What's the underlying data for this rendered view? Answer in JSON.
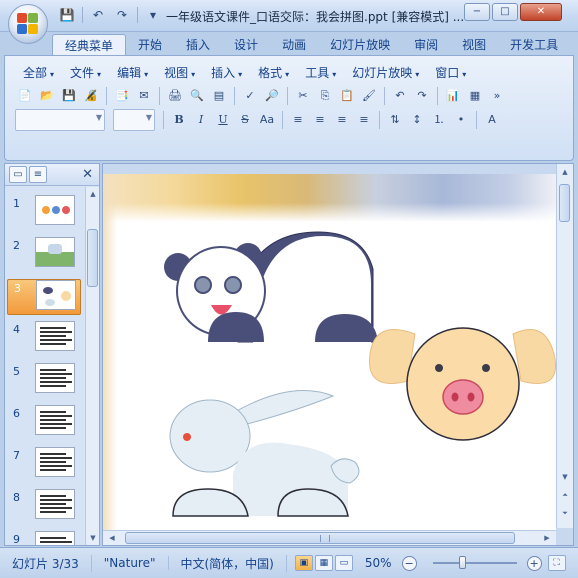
{
  "window": {
    "title": "一年级语文课件_口语交际：我会拼图.ppt [兼容模式] ...",
    "controls": [
      "−",
      "□",
      "✕"
    ]
  },
  "quick_access": {
    "icons": [
      "save-icon",
      "undo-icon",
      "redo-icon",
      "customize-icon"
    ],
    "glyphs": [
      "💾",
      "↶",
      "↷",
      "▾"
    ]
  },
  "ribbon_tabs": [
    "经典菜单",
    "开始",
    "插入",
    "设计",
    "动画",
    "幻灯片放映",
    "审阅",
    "视图",
    "开发工具"
  ],
  "active_tab": "经典菜单",
  "classic_menus": [
    "全部",
    "文件",
    "编辑",
    "视图",
    "插入",
    "格式",
    "工具",
    "幻灯片放映",
    "窗口"
  ],
  "toolbar1": [
    {
      "name": "new-icon",
      "glyph": "📄"
    },
    {
      "name": "open-icon",
      "glyph": "📂"
    },
    {
      "name": "save-icon",
      "glyph": "💾"
    },
    {
      "name": "permission-icon",
      "glyph": "🔏"
    },
    {
      "name": "sep"
    },
    {
      "name": "publish-icon",
      "glyph": "📑"
    },
    {
      "name": "email-icon",
      "glyph": "✉"
    },
    {
      "name": "sep"
    },
    {
      "name": "print-icon",
      "glyph": "🖨"
    },
    {
      "name": "print-preview-icon",
      "glyph": "🔍"
    },
    {
      "name": "page-setup-icon",
      "glyph": "▤"
    },
    {
      "name": "sep"
    },
    {
      "name": "spelling-icon",
      "glyph": "✓"
    },
    {
      "name": "research-icon",
      "glyph": "🔎"
    },
    {
      "name": "sep"
    },
    {
      "name": "cut-icon",
      "glyph": "✂"
    },
    {
      "name": "copy-icon",
      "glyph": "⎘"
    },
    {
      "name": "paste-icon",
      "glyph": "📋"
    },
    {
      "name": "format-painter-icon",
      "glyph": "🖌"
    },
    {
      "name": "sep"
    },
    {
      "name": "undo-icon",
      "glyph": "↶"
    },
    {
      "name": "redo-icon",
      "glyph": "↷"
    },
    {
      "name": "sep"
    },
    {
      "name": "chart-icon",
      "glyph": "📊"
    },
    {
      "name": "table-icon",
      "glyph": "▦"
    },
    {
      "name": "more-icon",
      "glyph": "»"
    }
  ],
  "toolbar2": [
    {
      "name": "bold-button",
      "glyph": "B",
      "cls": "b"
    },
    {
      "name": "italic-button",
      "glyph": "I",
      "cls": "i"
    },
    {
      "name": "underline-button",
      "glyph": "U",
      "cls": "u"
    },
    {
      "name": "strikethrough-button",
      "glyph": "S",
      "cls": "s"
    },
    {
      "name": "change-case-button",
      "glyph": "Aa",
      "cls": ""
    },
    {
      "name": "sep"
    },
    {
      "name": "align-left-icon",
      "glyph": "≡"
    },
    {
      "name": "align-center-icon",
      "glyph": "≡"
    },
    {
      "name": "align-right-icon",
      "glyph": "≡"
    },
    {
      "name": "justify-icon",
      "glyph": "≡"
    },
    {
      "name": "sep"
    },
    {
      "name": "text-direction-icon",
      "glyph": "⇅"
    },
    {
      "name": "line-spacing-icon",
      "glyph": "↕"
    },
    {
      "name": "numbering-icon",
      "glyph": "⒈"
    },
    {
      "name": "bullets-icon",
      "glyph": "•"
    },
    {
      "name": "sep"
    },
    {
      "name": "font-color-icon",
      "glyph": "A"
    }
  ],
  "font_name_value": "",
  "font_size_value": "",
  "slides": [
    {
      "num": "1"
    },
    {
      "num": "2"
    },
    {
      "num": "3"
    },
    {
      "num": "4"
    },
    {
      "num": "5"
    },
    {
      "num": "6"
    },
    {
      "num": "7"
    },
    {
      "num": "8"
    },
    {
      "num": "9"
    }
  ],
  "selected_slide": "3",
  "status": {
    "slide_info": "幻灯片 3/33",
    "theme": "\"Nature\"",
    "language": "中文(简体，中国)",
    "zoom": "50%"
  },
  "colors": {
    "selected_thumb": "#f39a3c",
    "panda_dark": "#4a4f7a",
    "pig_fill": "#f9d9a3",
    "pig_snout": "#f08ca0",
    "rabbit_fill": "#e6eef5"
  }
}
